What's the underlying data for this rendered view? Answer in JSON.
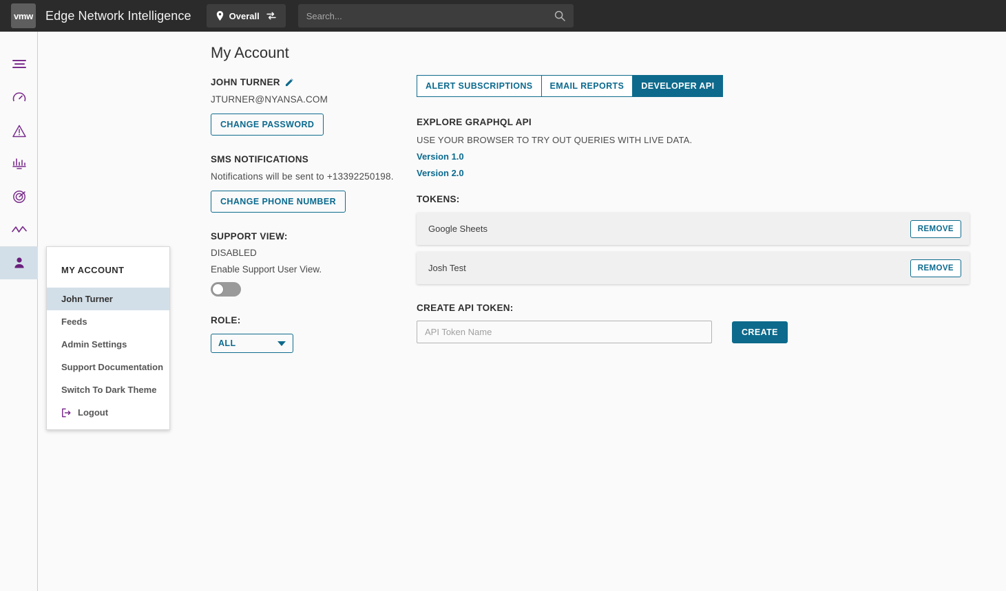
{
  "topbar": {
    "logo_text": "vmw",
    "app_title": "Edge Network Intelligence",
    "scope_label": "Overall",
    "search_placeholder": "Search...",
    "search_value": ""
  },
  "rail": {
    "items": [
      {
        "name": "menu-icon",
        "label": "Menu"
      },
      {
        "name": "dashboard-icon",
        "label": "Dashboard"
      },
      {
        "name": "alerts-icon",
        "label": "Alerts"
      },
      {
        "name": "analytics-icon",
        "label": "Analytics"
      },
      {
        "name": "scope-icon",
        "label": "Scope"
      },
      {
        "name": "trends-icon",
        "label": "Trends"
      },
      {
        "name": "account-icon",
        "label": "My Account"
      }
    ]
  },
  "flyout": {
    "title": "MY ACCOUNT",
    "items": [
      {
        "label": "John Turner",
        "selected": true
      },
      {
        "label": "Feeds",
        "selected": false
      },
      {
        "label": "Admin Settings",
        "selected": false
      },
      {
        "label": "Support Documentation",
        "selected": false
      },
      {
        "label": "Switch To Dark Theme",
        "selected": false
      },
      {
        "label": "Logout",
        "selected": false,
        "icon": "logout-icon"
      }
    ]
  },
  "page": {
    "title": "My Account"
  },
  "profile": {
    "name": "JOHN TURNER",
    "email": "JTURNER@NYANSA.COM",
    "change_password_label": "CHANGE PASSWORD"
  },
  "sms": {
    "heading": "SMS NOTIFICATIONS",
    "description": "Notifications will be sent to +13392250198.",
    "change_phone_label": "CHANGE PHONE NUMBER"
  },
  "support_view": {
    "heading": "SUPPORT VIEW:",
    "status": "DISABLED",
    "description": "Enable Support User View.",
    "toggle_on": false
  },
  "role": {
    "heading": "ROLE:",
    "selected": "ALL",
    "options": [
      "ALL"
    ]
  },
  "tabs": [
    {
      "label": "ALERT SUBSCRIPTIONS",
      "active": false
    },
    {
      "label": "EMAIL REPORTS",
      "active": false
    },
    {
      "label": "DEVELOPER API",
      "active": true
    }
  ],
  "developer_api": {
    "explore_heading": "EXPLORE GRAPHQL API",
    "explore_sub": "USE YOUR BROWSER TO TRY OUT QUERIES WITH LIVE DATA.",
    "version_links": [
      "Version 1.0",
      "Version 2.0"
    ],
    "tokens_heading": "TOKENS:",
    "tokens": [
      {
        "name": "Google Sheets",
        "remove_label": "REMOVE"
      },
      {
        "name": "Josh Test",
        "remove_label": "REMOVE"
      }
    ],
    "create_heading": "CREATE API TOKEN:",
    "token_input_placeholder": "API Token Name",
    "token_input_value": "",
    "create_label": "CREATE"
  },
  "colors": {
    "topbar_bg": "#2b2b2b",
    "accent_teal": "#0d6a8c",
    "rail_purple": "#7b2d8e",
    "selected_bg": "#d3dfe8",
    "page_bg": "#fafafa"
  }
}
